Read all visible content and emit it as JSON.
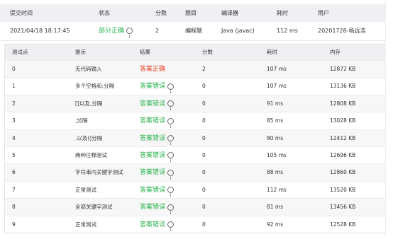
{
  "summary": {
    "headers": {
      "time": "提交时间",
      "status": "状态",
      "score": "分数",
      "problem": "题目",
      "compiler": "编译器",
      "elapsed": "耗时",
      "user": "用户"
    },
    "row": {
      "time": "2021/04/18 18:17:45",
      "status": "部分正确",
      "score": "2",
      "problem": "编程题",
      "compiler": "Java (javac)",
      "elapsed": "112 ms",
      "user": "20201728-杨远浩"
    }
  },
  "tests": {
    "headers": {
      "id": "测试点",
      "hint": "提示",
      "result": "结果",
      "score": "分数",
      "time": "耗时",
      "memory": "内存"
    },
    "rows": [
      {
        "id": "0",
        "hint": "无代码输入",
        "result": "答案正确",
        "correct": true,
        "score": "2",
        "time": "107 ms",
        "memory": "12872 KB"
      },
      {
        "id": "1",
        "hint": "多个空格和;分隔",
        "result": "答案错误",
        "correct": false,
        "score": "0",
        "time": "107 ms",
        "memory": "13136 KB"
      },
      {
        "id": "2",
        "hint": "[]以及,分隔",
        "result": "答案错误",
        "correct": false,
        "score": "0",
        "time": "91 ms",
        "memory": "12808 KB"
      },
      {
        "id": "3",
        "hint": ";分隔",
        "result": "答案错误",
        "correct": false,
        "score": "0",
        "time": "85 ms",
        "memory": "13028 KB"
      },
      {
        "id": "4",
        "hint": ".以及()分隔",
        "result": "答案错误",
        "correct": false,
        "score": "0",
        "time": "80 ms",
        "memory": "12412 KB"
      },
      {
        "id": "5",
        "hint": "两种注释测试",
        "result": "答案错误",
        "correct": false,
        "score": "0",
        "time": "105 ms",
        "memory": "12696 KB"
      },
      {
        "id": "6",
        "hint": "字符串内关键字测试",
        "result": "答案错误",
        "correct": false,
        "score": "0",
        "time": "88 ms",
        "memory": "12860 KB"
      },
      {
        "id": "7",
        "hint": "正常测试",
        "result": "答案错误",
        "correct": false,
        "score": "0",
        "time": "112 ms",
        "memory": "13520 KB"
      },
      {
        "id": "8",
        "hint": "全部关键字测试",
        "result": "答案错误",
        "correct": false,
        "score": "0",
        "time": "81 ms",
        "memory": "13456 KB"
      },
      {
        "id": "9",
        "hint": "正常测试",
        "result": "答案错误",
        "correct": false,
        "score": "0",
        "time": "92 ms",
        "memory": "12528 KB"
      }
    ]
  },
  "icons": {
    "info": "info-icon"
  },
  "colors": {
    "correct": "#e8452a",
    "wrong": "#2bb34f",
    "header_bg": "#eef0f3"
  }
}
